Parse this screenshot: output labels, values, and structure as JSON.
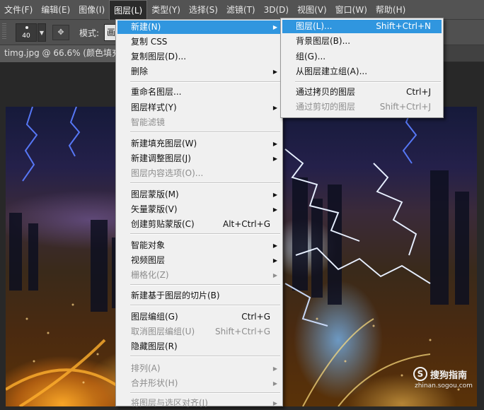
{
  "menubar": {
    "items": [
      {
        "label": "文件(F)"
      },
      {
        "label": "编辑(E)"
      },
      {
        "label": "图像(I)"
      },
      {
        "label": "图层(L)"
      },
      {
        "label": "类型(Y)"
      },
      {
        "label": "选择(S)"
      },
      {
        "label": "滤镜(T)"
      },
      {
        "label": "3D(D)"
      },
      {
        "label": "视图(V)"
      },
      {
        "label": "窗口(W)"
      },
      {
        "label": "帮助(H)"
      }
    ]
  },
  "options": {
    "brush_size": "40",
    "mode_label": "模式:",
    "mode_value": "画"
  },
  "document": {
    "tab_title": "timg.jpg @ 66.6% (颜色填充"
  },
  "layer_menu": {
    "items": [
      {
        "label": "新建(N)"
      },
      {
        "label": "复制 CSS"
      },
      {
        "label": "复制图层(D)..."
      },
      {
        "label": "删除"
      },
      {
        "label": "重命名图层..."
      },
      {
        "label": "图层样式(Y)"
      },
      {
        "label": "智能滤镜"
      },
      {
        "label": "新建填充图层(W)"
      },
      {
        "label": "新建调整图层(J)"
      },
      {
        "label": "图层内容选项(O)..."
      },
      {
        "label": "图层蒙版(M)"
      },
      {
        "label": "矢量蒙版(V)"
      },
      {
        "label": "创建剪贴蒙版(C)",
        "shortcut": "Alt+Ctrl+G"
      },
      {
        "label": "智能对象"
      },
      {
        "label": "视频图层"
      },
      {
        "label": "栅格化(Z)"
      },
      {
        "label": "新建基于图层的切片(B)"
      },
      {
        "label": "图层编组(G)",
        "shortcut": "Ctrl+G"
      },
      {
        "label": "取消图层编组(U)",
        "shortcut": "Shift+Ctrl+G"
      },
      {
        "label": "隐藏图层(R)"
      },
      {
        "label": "排列(A)"
      },
      {
        "label": "合并形状(H)"
      },
      {
        "label": "将图层与选区对齐(I)"
      }
    ]
  },
  "new_submenu": {
    "items": [
      {
        "label": "图层(L)...",
        "shortcut": "Shift+Ctrl+N"
      },
      {
        "label": "背景图层(B)..."
      },
      {
        "label": "组(G)..."
      },
      {
        "label": "从图层建立组(A)..."
      },
      {
        "label": "通过拷贝的图层",
        "shortcut": "Ctrl+J"
      },
      {
        "label": "通过剪切的图层",
        "shortcut": "Shift+Ctrl+J"
      }
    ]
  },
  "watermark": {
    "logo_letter": "S",
    "title": "搜狗指南",
    "url": "zhinan.sogou.com"
  },
  "colors": {
    "menu_highlight": "#3096df",
    "menu_background": "#f0f0f0",
    "menubar_background": "#535353",
    "disabled_text": "#8d8d8d"
  }
}
